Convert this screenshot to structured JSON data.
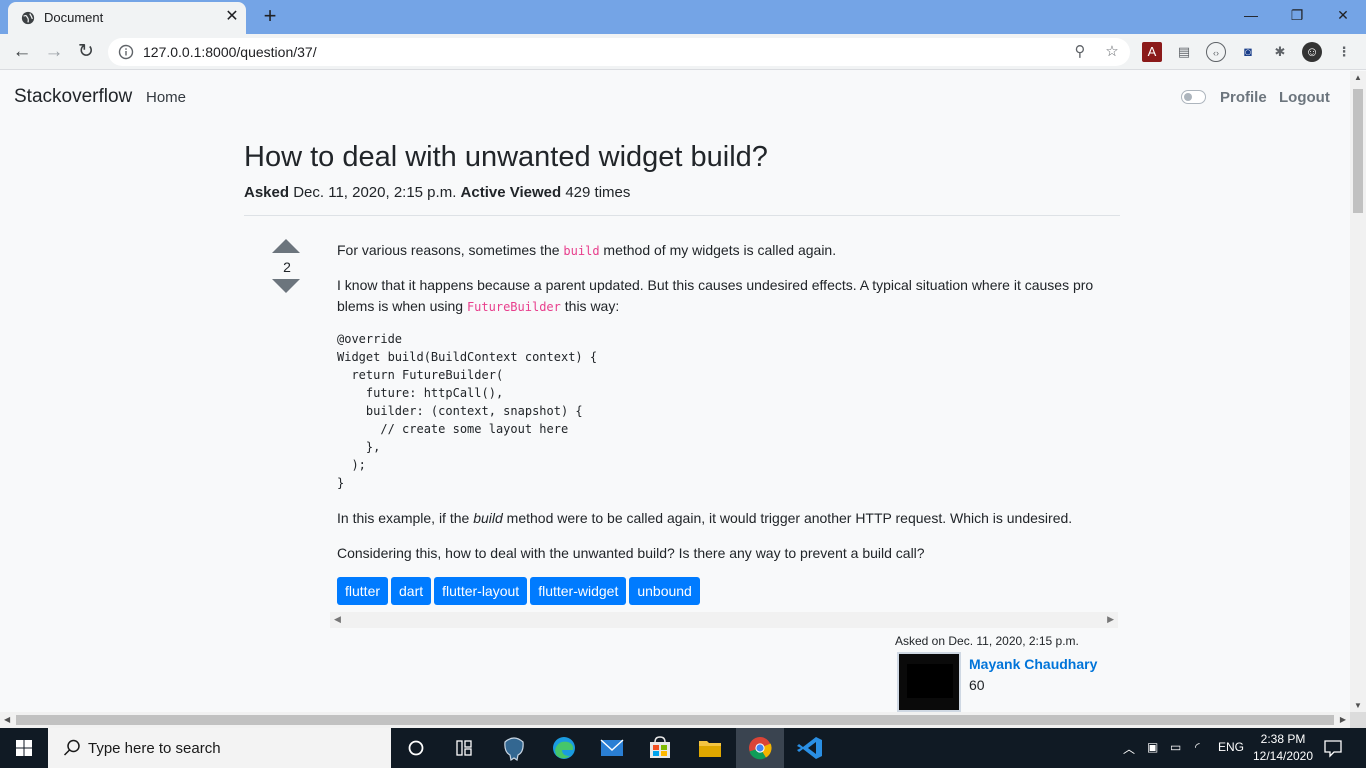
{
  "browser": {
    "tab_title": "Document",
    "tab_close": "✕",
    "new_tab": "+",
    "url": "127.0.0.1:8000/question/37/",
    "window_minimize": "—",
    "window_restore": "❐",
    "window_close": "✕"
  },
  "navbar": {
    "brand": "Stackoverflow",
    "home": "Home",
    "profile": "Profile",
    "logout": "Logout"
  },
  "question": {
    "title": "How to deal with unwanted widget build?",
    "asked_label": "Asked",
    "asked_value": "Dec. 11, 2020, 2:15 p.m.",
    "active_label": "Active",
    "viewed_label": "Viewed",
    "viewed_value": "429 times",
    "votes": "2",
    "p1_before": "For various reasons, sometimes the ",
    "p1_code": "build",
    "p1_after": " method of my widgets is called again.",
    "p2_line1": "I know that it happens because a parent updated. But this causes undesired effects. A typical situation where it causes pro",
    "p2_line2_before": "blems is when using ",
    "p2_code": "FutureBuilder",
    "p2_line2_after": " this way:",
    "code": "@override\nWidget build(BuildContext context) {\n  return FutureBuilder(\n    future: httpCall(),\n    builder: (context, snapshot) {\n      // create some layout here\n    },\n  );\n}",
    "p3_before": "In this example, if the ",
    "p3_em": "build",
    "p3_after": " method were to be called again, it would trigger another HTTP request. Which is undesired.",
    "p4": "Considering this, how to deal with the unwanted build? Is there any way to prevent a build call?",
    "tags": [
      "flutter",
      "dart",
      "flutter-layout",
      "flutter-widget",
      "unbound"
    ],
    "asked_on": "Asked on Dec. 11, 2020, 2:15 p.m.",
    "author_name": "Mayank Chaudhary",
    "author_rep": "60"
  },
  "taskbar": {
    "search_placeholder": "Type here to search",
    "language": "ENG",
    "time": "2:38 PM",
    "date": "12/14/2020"
  },
  "colors": {
    "tag_bg": "#007bff",
    "link": "#0074d9",
    "inline_code": "#e83e8c",
    "taskbar": "#101a24",
    "tabbar": "#74a4e6"
  }
}
